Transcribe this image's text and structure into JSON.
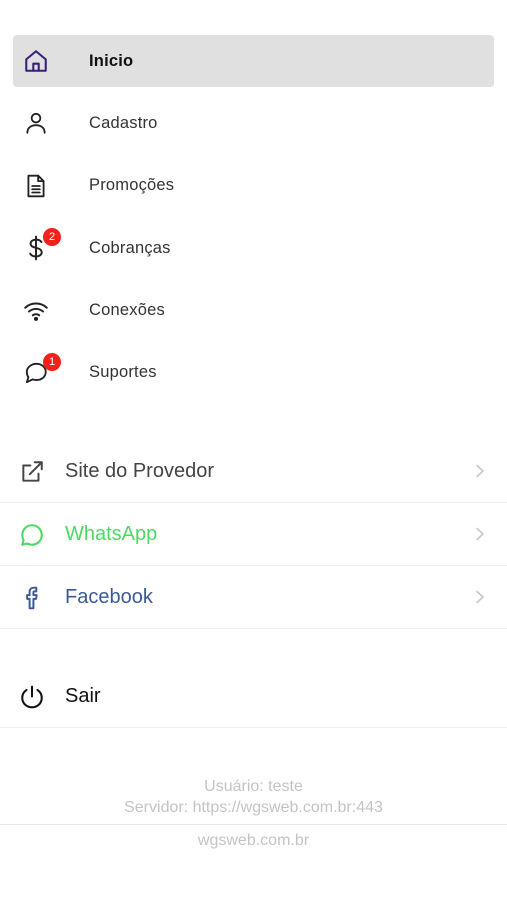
{
  "menu": {
    "items": [
      {
        "label": "Inicio",
        "icon": "home-icon",
        "active": true
      },
      {
        "label": "Cadastro",
        "icon": "user-icon"
      },
      {
        "label": "Promoções",
        "icon": "document-icon"
      },
      {
        "label": "Cobranças",
        "icon": "dollar-icon",
        "badge": "2"
      },
      {
        "label": "Conexões",
        "icon": "wifi-icon"
      },
      {
        "label": "Suportes",
        "icon": "chat-bubble-icon",
        "badge": "1"
      }
    ]
  },
  "links": {
    "items": [
      {
        "label": "Site do Provedor",
        "icon": "external-link-icon",
        "color": "#444444"
      },
      {
        "label": "WhatsApp",
        "icon": "whatsapp-icon",
        "color": "#4cd964"
      },
      {
        "label": "Facebook",
        "icon": "facebook-icon",
        "color": "#3b5998"
      }
    ]
  },
  "logout": {
    "label": "Sair",
    "icon": "power-icon"
  },
  "footer": {
    "user": "Usuário: teste",
    "server": "Servidor: https://wgsweb.com.br:443",
    "domain": "wgsweb.com.br"
  },
  "colors": {
    "accent": "#3a1e78",
    "active_bg": "#e0e0e0",
    "badge": "#f2221b",
    "whatsapp": "#4cd964",
    "facebook": "#3b5998",
    "footer_text": "#c4c4c4"
  }
}
